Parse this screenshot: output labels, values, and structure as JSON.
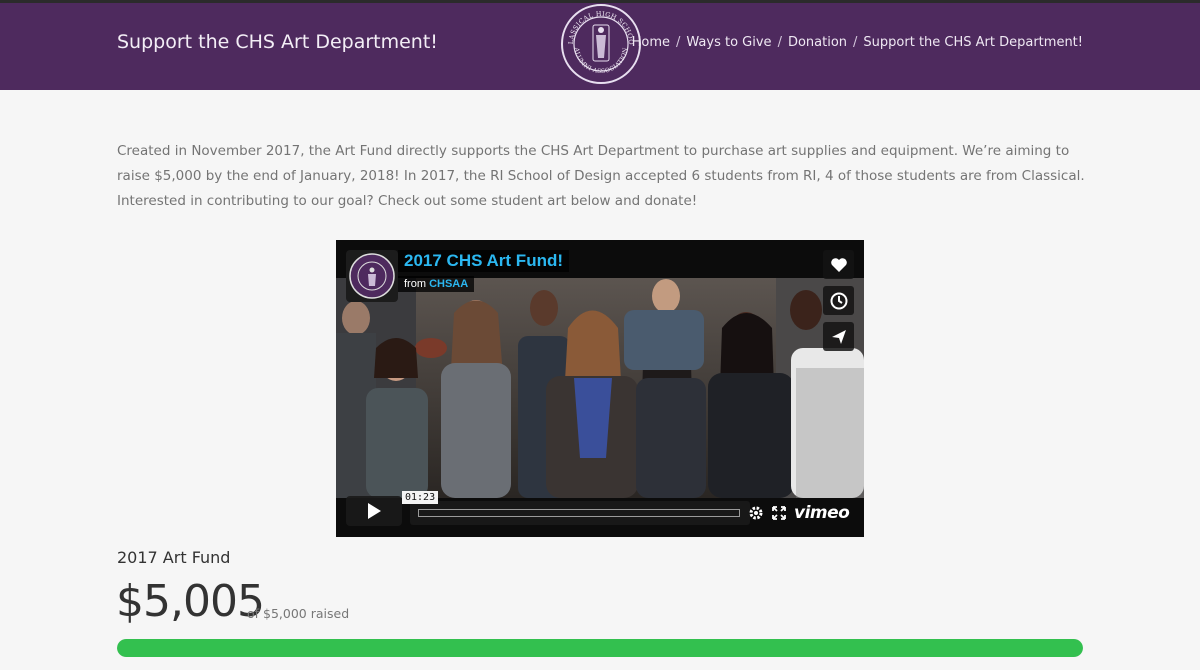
{
  "header": {
    "title": "Support the CHS Art Department!",
    "logo_text_top": "CLASSICAL HIGH SCHOOL",
    "logo_text_bottom": "ALUMNI ASSOCIATION",
    "breadcrumbs": [
      "Home",
      "Ways to Give",
      "Donation",
      "Support the CHS Art Department!"
    ]
  },
  "intro": "Created in November 2017, the Art Fund directly supports the CHS Art Department to purchase art supplies and equipment. We’re aiming to raise $5,000 by the end of January, 2018! In 2017, the RI School of Design accepted 6 students from RI, 4 of those students are from Classical. Interested in contributing to our goal? Check out some student art below and donate!",
  "video": {
    "title": "2017 CHS Art Fund!",
    "from_label": "from",
    "from_name": "CHSAA",
    "timecode": "01:23",
    "brand": "vimeo",
    "icons": [
      "heart-icon",
      "clock-icon",
      "send-icon",
      "play-icon",
      "gear-icon",
      "fullscreen-icon"
    ]
  },
  "fund": {
    "title": "2017 Art Fund",
    "raised": "$5,005",
    "goal_text": "of $5,000 raised",
    "progress_fraction": 1.0
  },
  "colors": {
    "header_bg": "#4e2a5e",
    "progress_fill": "#33c04f",
    "video_title": "#2bb7f0"
  }
}
